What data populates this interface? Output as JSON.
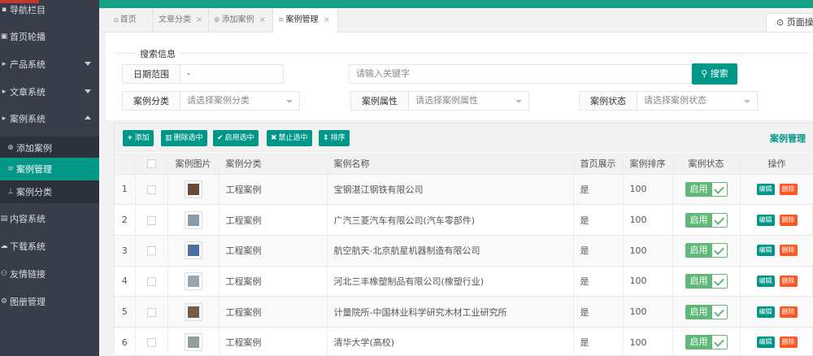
{
  "sidebar": {
    "items": [
      {
        "label": "导航栏目",
        "icon": "menu-icon",
        "glyph": "▪",
        "has_arrow": false
      },
      {
        "label": "首页轮播",
        "icon": "image-icon",
        "glyph": "▣",
        "has_arrow": false
      },
      {
        "label": "产品系统",
        "icon": "product-icon",
        "glyph": "▸",
        "has_arrow": true,
        "expanded": false
      },
      {
        "label": "文章系统",
        "icon": "article-icon",
        "glyph": "▸",
        "has_arrow": true,
        "expanded": false
      },
      {
        "label": "案例系统",
        "icon": "case-icon",
        "glyph": "▸",
        "has_arrow": true,
        "expanded": true
      },
      {
        "label": "添加案例",
        "icon": "plus-circle-icon",
        "glyph": "⊕",
        "sub": true
      },
      {
        "label": "案例管理",
        "icon": "list-icon",
        "glyph": "≡",
        "sub": true,
        "active": true
      },
      {
        "label": "案例分类",
        "icon": "sitemap-icon",
        "glyph": "⊥",
        "sub": true
      },
      {
        "label": "内容系统",
        "icon": "content-icon",
        "glyph": "▤",
        "has_arrow": false
      },
      {
        "label": "下载系统",
        "icon": "download-icon",
        "glyph": "☁",
        "has_arrow": false
      },
      {
        "label": "友情链接",
        "icon": "link-icon",
        "glyph": "⚇",
        "has_arrow": false
      },
      {
        "label": "图册管理",
        "icon": "gallery-icon",
        "glyph": "⚙",
        "has_arrow": false
      }
    ]
  },
  "tabs": [
    {
      "label": "首页",
      "icon": "home-icon",
      "glyph": "⌂",
      "closable": false
    },
    {
      "label": "文章分类",
      "closable": true
    },
    {
      "label": "添加案例",
      "icon": "plus-circle-icon",
      "glyph": "⊕",
      "closable": true
    },
    {
      "label": "案例管理",
      "icon": "list-icon",
      "glyph": "≡",
      "closable": true,
      "active": true
    }
  ],
  "page_op": {
    "label": "页面操作",
    "glyph": "⊙"
  },
  "search": {
    "legend": "搜索信息",
    "date_label": "日期范围",
    "date_value": "-",
    "keyword_placeholder": "请输入关键字",
    "search_button": "搜索",
    "category_label": "案例分类",
    "category_placeholder": "请选择案例分类",
    "attr_label": "案例属性",
    "attr_placeholder": "请选择案例属性",
    "status_label": "案例状态",
    "status_placeholder": "请选择案例状态"
  },
  "toolbar": {
    "add": "添加",
    "delete_selected": "删除选中",
    "enable_selected": "启用选中",
    "disable_selected": "禁止选中",
    "sort": "排序",
    "title": "案例管理"
  },
  "table": {
    "headers": [
      "",
      "",
      "案例图片",
      "案例分类",
      "案例名称",
      "首页展示",
      "案例排序",
      "案例状态",
      "操作"
    ],
    "rows": [
      {
        "id": "1",
        "category": "工程案例",
        "name": "宝钢湛江钢铁有限公司",
        "home": "是",
        "order": "100",
        "status": "启用",
        "thumb": "#6b4a3a"
      },
      {
        "id": "2",
        "category": "工程案例",
        "name": "广汽三菱汽车有限公司(汽车零部件)",
        "home": "是",
        "order": "100",
        "status": "启用",
        "thumb": "#8a9aa8"
      },
      {
        "id": "3",
        "category": "工程案例",
        "name": "航空航天-北京航星机器制造有限公司",
        "home": "是",
        "order": "100",
        "status": "启用",
        "thumb": "#4a6fa5"
      },
      {
        "id": "4",
        "category": "工程案例",
        "name": "河北三丰橡塑制品有限公司(橡塑行业)",
        "home": "是",
        "order": "100",
        "status": "启用",
        "thumb": "#9aa7b0"
      },
      {
        "id": "5",
        "category": "工程案例",
        "name": "计量院所-中国林业科学研究木材工业研究所",
        "home": "是",
        "order": "100",
        "status": "启用",
        "thumb": "#7a5a40"
      },
      {
        "id": "6",
        "category": "工程案例",
        "name": "清华大学(高校)",
        "home": "是",
        "order": "100",
        "status": "启用",
        "thumb": "#8fa0a0"
      }
    ],
    "edit_label": "编辑",
    "delete_label": "删除"
  }
}
